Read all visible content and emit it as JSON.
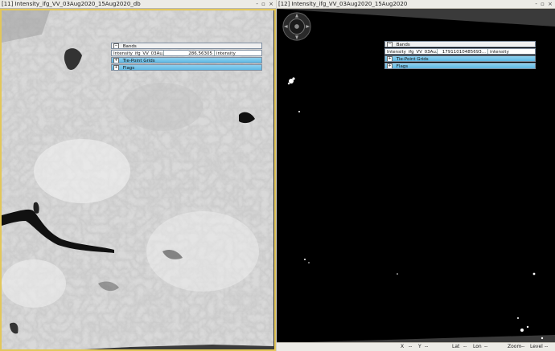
{
  "left_view": {
    "title": "[11] Intensity_ifg_VV_03Aug2020_15Aug2020_db",
    "bands_label": "Bands",
    "band_name": "Intensity_ifg_VV_03Au...",
    "band_value": "286.56305",
    "band_unit": "intensity",
    "tiepoint_label": "Tie-Point Grids",
    "flags_label": "Flags"
  },
  "right_view": {
    "title": "[12] Intensity_ifg_VV_03Aug2020_15Aug2020",
    "bands_label": "Bands",
    "band_name": "Intensity_ifg_VV_03Au...",
    "band_value": "17911010485693...",
    "band_unit": "intensity",
    "tiepoint_label": "Tie-Point Grids",
    "flags_label": "Flags"
  },
  "window_controls": "- ▫ ×",
  "toggle_symbol": "−",
  "toggle_expand_symbol": "+",
  "status_bar": {
    "x_label": "X",
    "x_sep": "--",
    "y_label": "Y",
    "y_sep": "--",
    "lat_label": "Lat",
    "lat_sep": "--",
    "lon_label": "Lon",
    "lon_sep": "--",
    "zoom_label": "Zoom",
    "zoom_sep": "--",
    "level_label": "Level",
    "level_sep": "--"
  },
  "colors": {
    "selected_border": "#e3c75a",
    "panel_blue": "#5db8e4"
  }
}
